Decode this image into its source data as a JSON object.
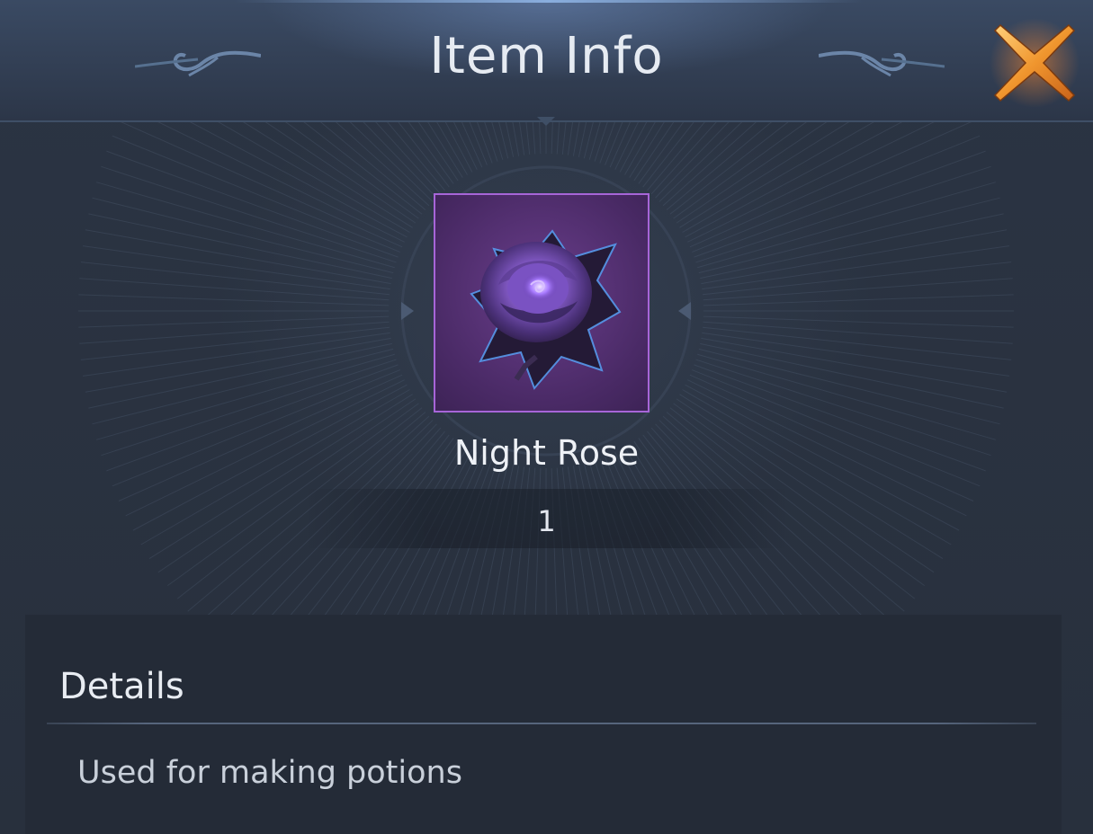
{
  "header": {
    "title": "Item Info"
  },
  "item": {
    "icon": "night-rose-icon",
    "name": "Night Rose",
    "quantity": "1",
    "rarity_color": "#a765d8"
  },
  "details": {
    "heading": "Details",
    "description": "Used for making potions"
  },
  "colors": {
    "close_accent": "#f0a040",
    "panel_background": "#28313f"
  }
}
